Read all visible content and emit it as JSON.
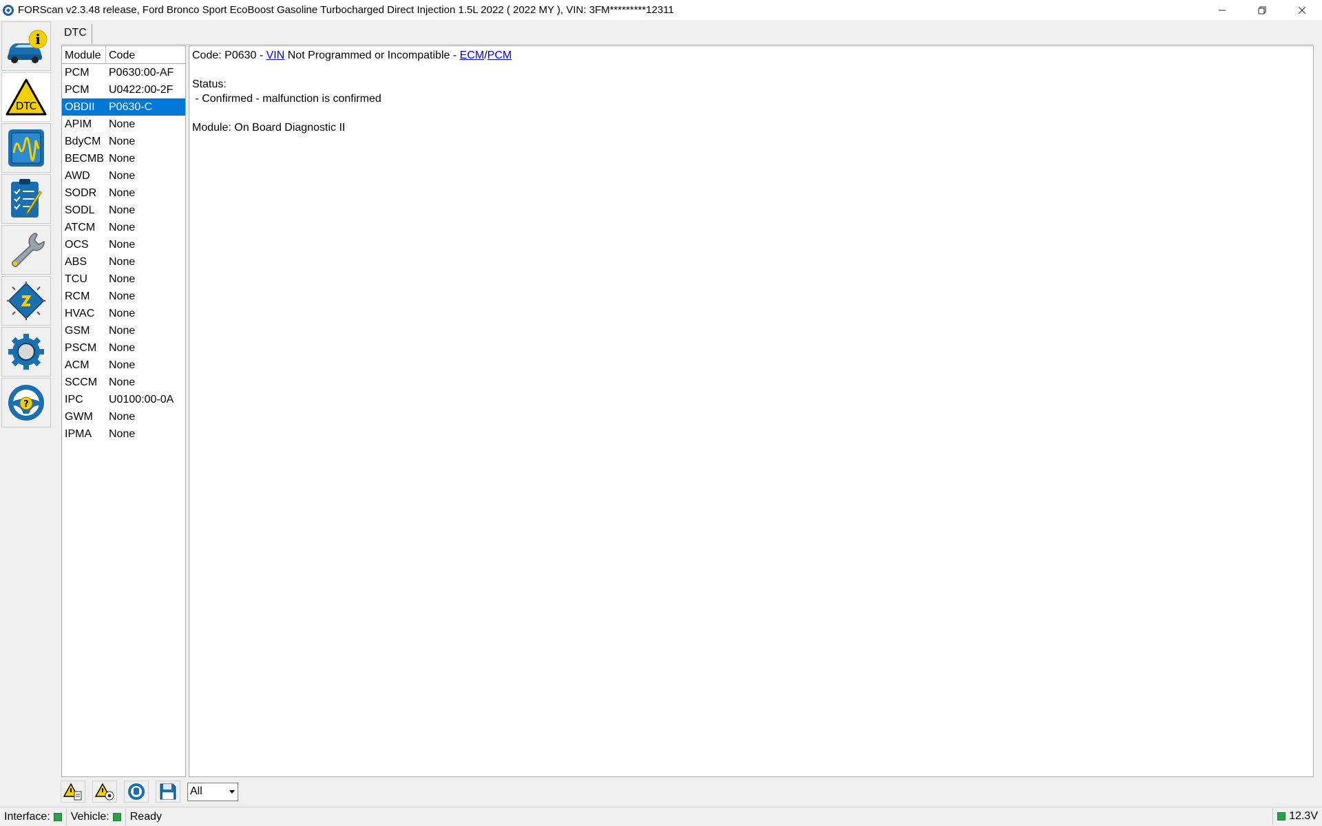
{
  "window": {
    "title": "FORScan v2.3.48 release, Ford Bronco Sport EcoBoost Gasoline Turbocharged Direct Injection 1.5L 2022 ( 2022 MY ), VIN: 3FM*********12311",
    "controls": [
      "minimize",
      "restore",
      "close"
    ]
  },
  "sidebar": {
    "items": [
      {
        "name": "vehicle-info",
        "icon": "car-info-icon"
      },
      {
        "name": "dtc",
        "icon": "dtc-warning-icon",
        "label": "DTC",
        "active": true
      },
      {
        "name": "oscilloscope",
        "icon": "oscilloscope-icon"
      },
      {
        "name": "tests",
        "icon": "checklist-icon"
      },
      {
        "name": "service",
        "icon": "wrench-icon"
      },
      {
        "name": "configuration",
        "icon": "chip-icon"
      },
      {
        "name": "settings",
        "icon": "gear-icon"
      },
      {
        "name": "help",
        "icon": "help-steering-wheel-icon"
      }
    ]
  },
  "tab": {
    "label": "DTC"
  },
  "module_list": {
    "headers": {
      "module": "Module",
      "code": "Code"
    },
    "rows": [
      {
        "module": "PCM",
        "code": "P0630:00-AF"
      },
      {
        "module": "PCM",
        "code": "U0422:00-2F"
      },
      {
        "module": "OBDII",
        "code": "P0630-C",
        "selected": true
      },
      {
        "module": "APIM",
        "code": "None"
      },
      {
        "module": "BdyCM",
        "code": "None"
      },
      {
        "module": "BECMB",
        "code": "None"
      },
      {
        "module": "AWD",
        "code": "None"
      },
      {
        "module": "SODR",
        "code": "None"
      },
      {
        "module": "SODL",
        "code": "None"
      },
      {
        "module": "ATCM",
        "code": "None"
      },
      {
        "module": "OCS",
        "code": "None"
      },
      {
        "module": "ABS",
        "code": "None"
      },
      {
        "module": "TCU",
        "code": "None"
      },
      {
        "module": "RCM",
        "code": "None"
      },
      {
        "module": "HVAC",
        "code": "None"
      },
      {
        "module": "GSM",
        "code": "None"
      },
      {
        "module": "PSCM",
        "code": "None"
      },
      {
        "module": "ACM",
        "code": "None"
      },
      {
        "module": "SCCM",
        "code": "None"
      },
      {
        "module": "IPC",
        "code": "U0100:00-0A"
      },
      {
        "module": "GWM",
        "code": "None"
      },
      {
        "module": "IPMA",
        "code": "None"
      }
    ]
  },
  "detail": {
    "code_prefix": "Code: P0630 - ",
    "vin_link": "VIN",
    "code_desc": " Not Programmed or Incompatible - ",
    "ecm_link": "ECM",
    "slash": "/",
    "pcm_link": "PCM",
    "status_label": "Status:",
    "status_value": " - Confirmed - malfunction is confirmed",
    "module_line": "Module: On Board Diagnostic II"
  },
  "toolbar": {
    "buttons": [
      "read-dtc-icon",
      "clear-dtc-icon",
      "database-icon",
      "save-icon"
    ],
    "filter_value": "All"
  },
  "statusbar": {
    "interface_label": "Interface:",
    "vehicle_label": "Vehicle:",
    "status_text": "Ready",
    "voltage": "12.3V",
    "indicator_color": "#2aa04a"
  },
  "colors": {
    "selection": "#0078d7",
    "link": "#0000ee",
    "icon_blue": "#1a6fb0",
    "icon_yellow": "#f5d000"
  }
}
